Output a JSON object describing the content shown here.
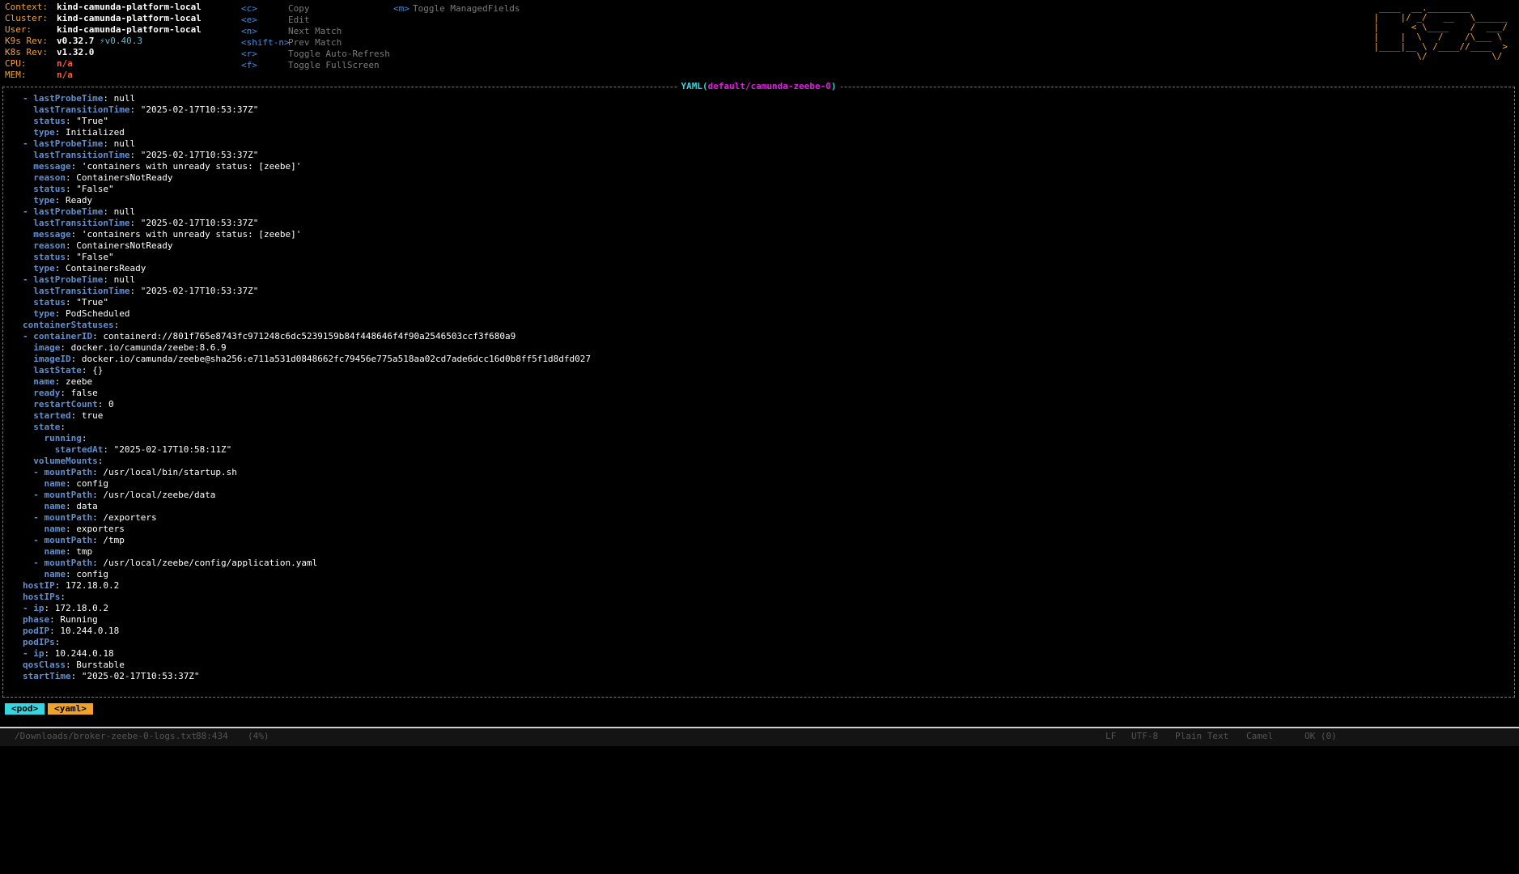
{
  "cluster_info": [
    {
      "key": "Context:",
      "value": "kind-camunda-platform-local",
      "color": "white"
    },
    {
      "key": "Cluster:",
      "value": "kind-camunda-platform-local",
      "color": "white"
    },
    {
      "key": "User:",
      "value": "kind-camunda-platform-local",
      "color": "white"
    },
    {
      "key": "K9s Rev:",
      "value": "v0.32.7",
      "extra": "⚡v0.40.3",
      "color": "white"
    },
    {
      "key": "K8s Rev:",
      "value": "v1.32.0",
      "color": "white"
    },
    {
      "key": "CPU:",
      "value": "n/a",
      "color": "red"
    },
    {
      "key": "MEM:",
      "value": "n/a",
      "color": "red"
    }
  ],
  "shortcuts_col1": [
    {
      "key": "<c>",
      "label": "Copy"
    },
    {
      "key": "<e>",
      "label": "Edit"
    },
    {
      "key": "<n>",
      "label": "Next Match"
    },
    {
      "key": "<shift-n>",
      "label": "Prev Match"
    },
    {
      "key": "<r>",
      "label": "Toggle Auto-Refresh"
    },
    {
      "key": "<f>",
      "label": "Toggle FullScreen"
    }
  ],
  "shortcuts_col2": [
    {
      "key": "<m>",
      "label": "Toggle ManagedFields"
    }
  ],
  "logo_icon": "k9s-ascii-logo",
  "logo_lines": [
    " ____  __.________       ",
    "|    |/ _/   __   \\______",
    "|      < \\____    /  ___/",
    "|    |  \\   /    /\\___ \\ ",
    "|____|__ \\ /____//____  >",
    "        \\/            \\/ "
  ],
  "view": {
    "kind": "YAML",
    "resource": "default/camunda-zeebe-0"
  },
  "yaml_lines": [
    {
      "indent": 0,
      "dash": true,
      "key": "lastProbeTime",
      "value": "null"
    },
    {
      "indent": 1,
      "dash": false,
      "key": "lastTransitionTime",
      "value": "\"2025-02-17T10:53:37Z\""
    },
    {
      "indent": 1,
      "dash": false,
      "key": "status",
      "value": "\"True\""
    },
    {
      "indent": 1,
      "dash": false,
      "key": "type",
      "value": "Initialized"
    },
    {
      "indent": 0,
      "dash": true,
      "key": "lastProbeTime",
      "value": "null"
    },
    {
      "indent": 1,
      "dash": false,
      "key": "lastTransitionTime",
      "value": "\"2025-02-17T10:53:37Z\""
    },
    {
      "indent": 1,
      "dash": false,
      "key": "message",
      "value": "'containers with unready status: [zeebe]'"
    },
    {
      "indent": 1,
      "dash": false,
      "key": "reason",
      "value": "ContainersNotReady"
    },
    {
      "indent": 1,
      "dash": false,
      "key": "status",
      "value": "\"False\""
    },
    {
      "indent": 1,
      "dash": false,
      "key": "type",
      "value": "Ready"
    },
    {
      "indent": 0,
      "dash": true,
      "key": "lastProbeTime",
      "value": "null"
    },
    {
      "indent": 1,
      "dash": false,
      "key": "lastTransitionTime",
      "value": "\"2025-02-17T10:53:37Z\""
    },
    {
      "indent": 1,
      "dash": false,
      "key": "message",
      "value": "'containers with unready status: [zeebe]'"
    },
    {
      "indent": 1,
      "dash": false,
      "key": "reason",
      "value": "ContainersNotReady"
    },
    {
      "indent": 1,
      "dash": false,
      "key": "status",
      "value": "\"False\""
    },
    {
      "indent": 1,
      "dash": false,
      "key": "type",
      "value": "ContainersReady"
    },
    {
      "indent": 0,
      "dash": true,
      "key": "lastProbeTime",
      "value": "null"
    },
    {
      "indent": 1,
      "dash": false,
      "key": "lastTransitionTime",
      "value": "\"2025-02-17T10:53:37Z\""
    },
    {
      "indent": 1,
      "dash": false,
      "key": "status",
      "value": "\"True\""
    },
    {
      "indent": 1,
      "dash": false,
      "key": "type",
      "value": "PodScheduled"
    },
    {
      "indent": 0,
      "dash": false,
      "key": "containerStatuses",
      "value": ""
    },
    {
      "indent": 0,
      "dash": true,
      "key": "containerID",
      "value": "containerd://801f765e8743fc971248c6dc5239159b84f448646f4f90a2546503ccf3f680a9"
    },
    {
      "indent": 1,
      "dash": false,
      "key": "image",
      "value": "docker.io/camunda/zeebe:8.6.9"
    },
    {
      "indent": 1,
      "dash": false,
      "key": "imageID",
      "value": "docker.io/camunda/zeebe@sha256:e711a531d0848662fc79456e775a518aa02cd7ade6dcc16d0b8ff5f1d8dfd027"
    },
    {
      "indent": 1,
      "dash": false,
      "key": "lastState",
      "value": "{}"
    },
    {
      "indent": 1,
      "dash": false,
      "key": "name",
      "value": "zeebe"
    },
    {
      "indent": 1,
      "dash": false,
      "key": "ready",
      "value": "false"
    },
    {
      "indent": 1,
      "dash": false,
      "key": "restartCount",
      "value": "0"
    },
    {
      "indent": 1,
      "dash": false,
      "key": "started",
      "value": "true"
    },
    {
      "indent": 1,
      "dash": false,
      "key": "state",
      "value": ""
    },
    {
      "indent": 2,
      "dash": false,
      "key": "running",
      "value": ""
    },
    {
      "indent": 3,
      "dash": false,
      "key": "startedAt",
      "value": "\"2025-02-17T10:58:11Z\""
    },
    {
      "indent": 1,
      "dash": false,
      "key": "volumeMounts",
      "value": ""
    },
    {
      "indent": 1,
      "dash": true,
      "key": "mountPath",
      "value": "/usr/local/bin/startup.sh"
    },
    {
      "indent": 2,
      "dash": false,
      "key": "name",
      "value": "config"
    },
    {
      "indent": 1,
      "dash": true,
      "key": "mountPath",
      "value": "/usr/local/zeebe/data"
    },
    {
      "indent": 2,
      "dash": false,
      "key": "name",
      "value": "data"
    },
    {
      "indent": 1,
      "dash": true,
      "key": "mountPath",
      "value": "/exporters"
    },
    {
      "indent": 2,
      "dash": false,
      "key": "name",
      "value": "exporters"
    },
    {
      "indent": 1,
      "dash": true,
      "key": "mountPath",
      "value": "/tmp"
    },
    {
      "indent": 2,
      "dash": false,
      "key": "name",
      "value": "tmp"
    },
    {
      "indent": 1,
      "dash": true,
      "key": "mountPath",
      "value": "/usr/local/zeebe/config/application.yaml"
    },
    {
      "indent": 2,
      "dash": false,
      "key": "name",
      "value": "config"
    },
    {
      "indent": 0,
      "dash": false,
      "key": "hostIP",
      "value": "172.18.0.2"
    },
    {
      "indent": 0,
      "dash": false,
      "key": "hostIPs",
      "value": ""
    },
    {
      "indent": 0,
      "dash": true,
      "key": "ip",
      "value": "172.18.0.2"
    },
    {
      "indent": 0,
      "dash": false,
      "key": "phase",
      "value": "Running"
    },
    {
      "indent": 0,
      "dash": false,
      "key": "podIP",
      "value": "10.244.0.18"
    },
    {
      "indent": 0,
      "dash": false,
      "key": "podIPs",
      "value": ""
    },
    {
      "indent": 0,
      "dash": true,
      "key": "ip",
      "value": "10.244.0.18"
    },
    {
      "indent": 0,
      "dash": false,
      "key": "qosClass",
      "value": "Burstable"
    },
    {
      "indent": 0,
      "dash": false,
      "key": "startTime",
      "value": "\"2025-02-17T10:53:37Z\""
    }
  ],
  "breadcrumbs": [
    "<pod>",
    "<yaml>"
  ],
  "footer": {
    "left": "/Downloads/broker-zeebe-0-logs.txt",
    "position": "88:434",
    "pct": "(4%)",
    "eol": "LF",
    "encoding": "UTF-8",
    "syntax": "Plain Text",
    "branch": "Camel",
    "status": "OK (0)"
  }
}
